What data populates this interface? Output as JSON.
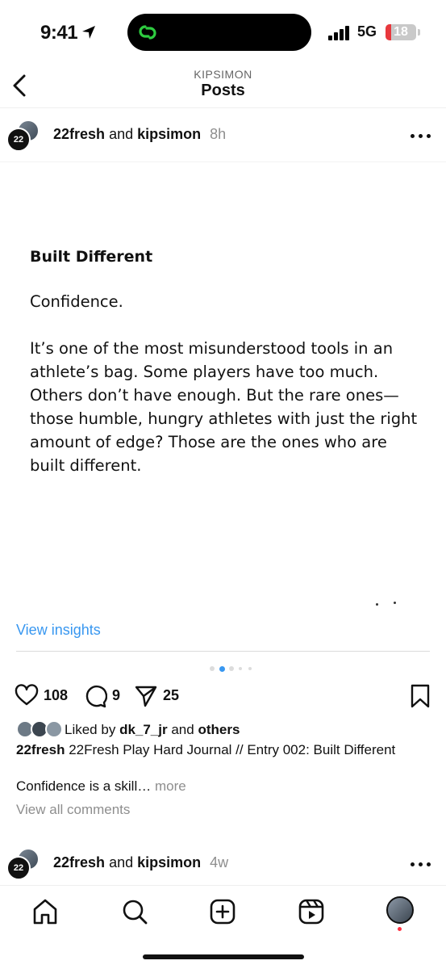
{
  "status_bar": {
    "time": "9:41",
    "network": "5G",
    "battery": "18",
    "battery_level_percent": 18,
    "accent_color": "#2ecc40"
  },
  "header": {
    "subtitle": "KIPSIMON",
    "title": "Posts"
  },
  "post": {
    "author_1": "22fresh",
    "joiner": "and",
    "author_2": "kipsimon",
    "time": "8h",
    "avatar_logo_text": "22",
    "slide": {
      "title": "Built Different",
      "paragraph_1": "Confidence.",
      "paragraph_2": "It’s one of the most misunderstood tools in an athlete’s bag. Some players have too much. Others don’t have enough. But the rare ones—those humble, hungry athletes with just the right amount of edge? Those are the ones who are built different."
    },
    "insights_label": "View insights",
    "carousel": {
      "count": 5,
      "active_index": 1
    },
    "likes": "108",
    "comments": "9",
    "shares": "25",
    "liked_by_prefix": "Liked by",
    "liked_by_user": "dk_7_jr",
    "liked_by_and": "and",
    "liked_by_others": "others",
    "caption_user": "22fresh",
    "caption_text": "22Fresh Play Hard Journal // Entry 002: Built Different",
    "caption_2": "Confidence is a skill…",
    "more_label": "more",
    "view_all_comments": "View all comments"
  },
  "next_post": {
    "author_1": "22fresh",
    "joiner": "and",
    "author_2": "kipsimon",
    "time": "4w",
    "avatar_logo_text": "22"
  },
  "bottom_nav": {
    "items": [
      "home-icon",
      "search-icon",
      "create-icon",
      "reels-icon",
      "profile-avatar"
    ]
  },
  "colors": {
    "link_blue": "#3897f0",
    "active_dot": "#3897f0",
    "notification_red": "#ff3040"
  }
}
